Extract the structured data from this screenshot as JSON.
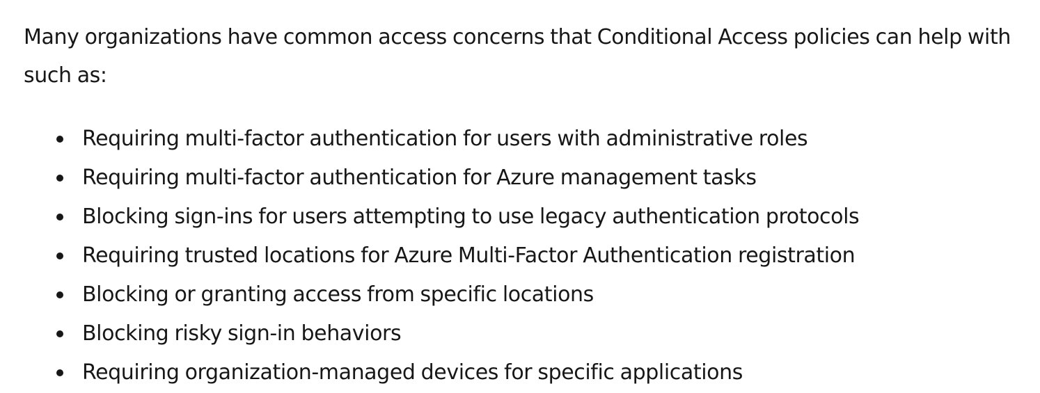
{
  "intro": "Many organizations have common access concerns that Conditional Access policies can help with such as:",
  "items": [
    "Requiring multi-factor authentication for users with administrative roles",
    "Requiring multi-factor authentication for Azure management tasks",
    "Blocking sign-ins for users attempting to use legacy authentication protocols",
    "Requiring trusted locations for Azure Multi-Factor Authentication registration",
    "Blocking or granting access from specific locations",
    "Blocking risky sign-in behaviors",
    "Requiring organization-managed devices for specific applications"
  ],
  "icons": {
    "bullet": "bullet-dot-icon"
  },
  "colors": {
    "text": "#171717",
    "background": "#ffffff"
  }
}
